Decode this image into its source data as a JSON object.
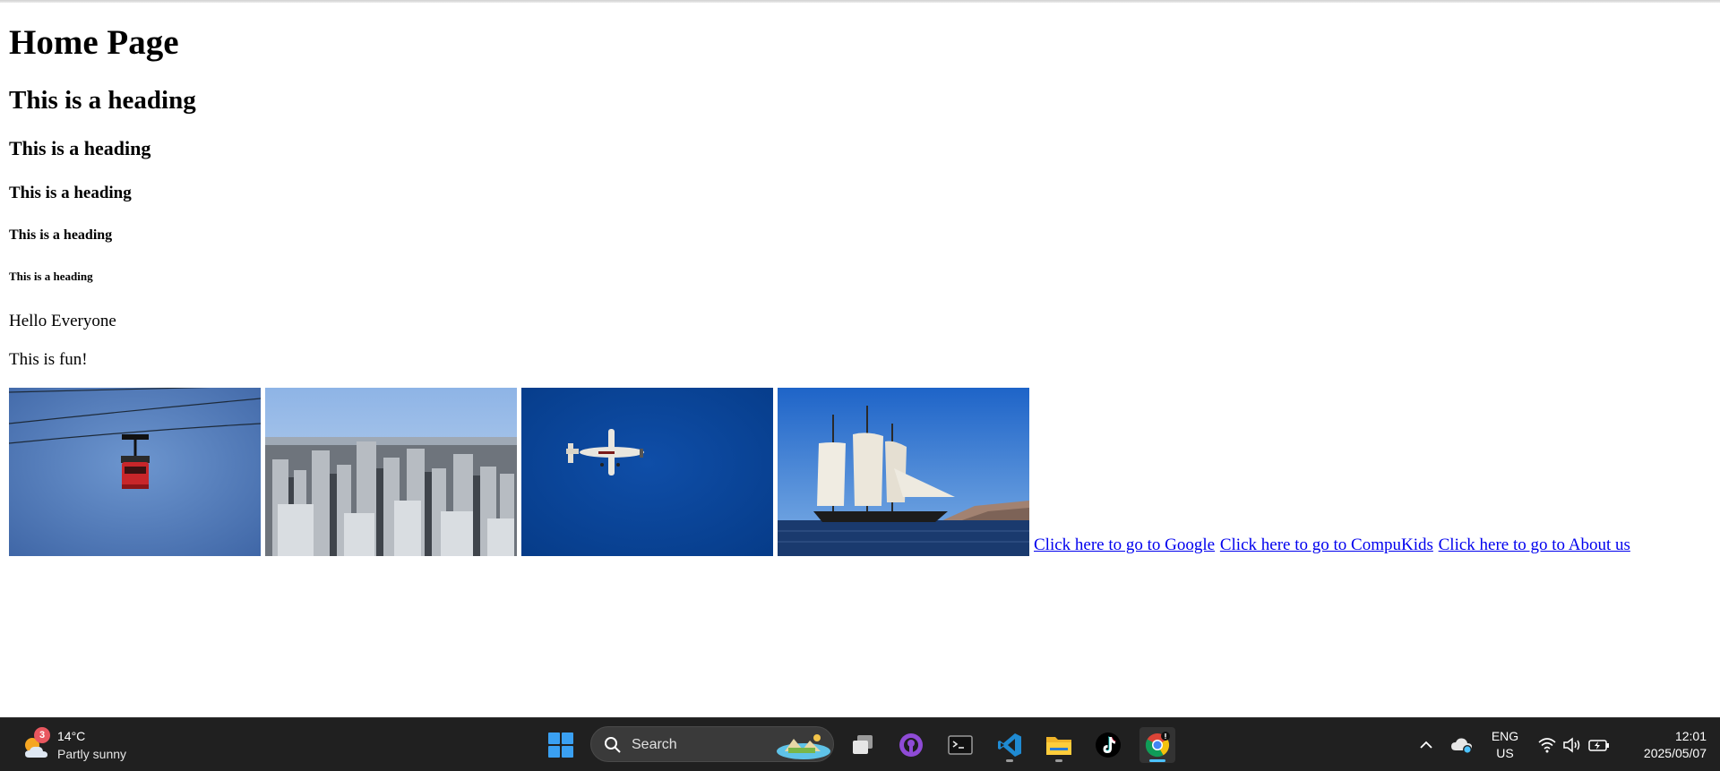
{
  "page": {
    "h1": "Home Page",
    "h2": "This is a heading",
    "h3": "This is a heading",
    "h4": "This is a heading",
    "h5": "This is a heading",
    "h6": "This is a heading",
    "paragraphs": [
      "Hello Everyone",
      "This is fun!"
    ],
    "images": [
      {
        "subject": "cable-car"
      },
      {
        "subject": "city-skyline"
      },
      {
        "subject": "airplane"
      },
      {
        "subject": "sailing-ship"
      }
    ],
    "links": [
      {
        "label": "Click here to go to Google"
      },
      {
        "label": "Click here to go to CompuKids"
      },
      {
        "label": "Click here to go to About us"
      }
    ],
    "link_color": "#0000ee"
  },
  "taskbar": {
    "weather": {
      "badge": "3",
      "temperature": "14°C",
      "description": "Partly sunny"
    },
    "search": {
      "label": "Search"
    },
    "apps": [
      "task-view-icon",
      "github-desktop-icon",
      "terminal-icon",
      "vscode-icon",
      "file-explorer-icon",
      "tiktok-icon",
      "chrome-icon"
    ],
    "tray": {
      "language_line1": "ENG",
      "language_line2": "US"
    },
    "clock": {
      "time": "12:01",
      "date": "2025/05/07"
    },
    "accent_color": "#4cc2ff"
  }
}
